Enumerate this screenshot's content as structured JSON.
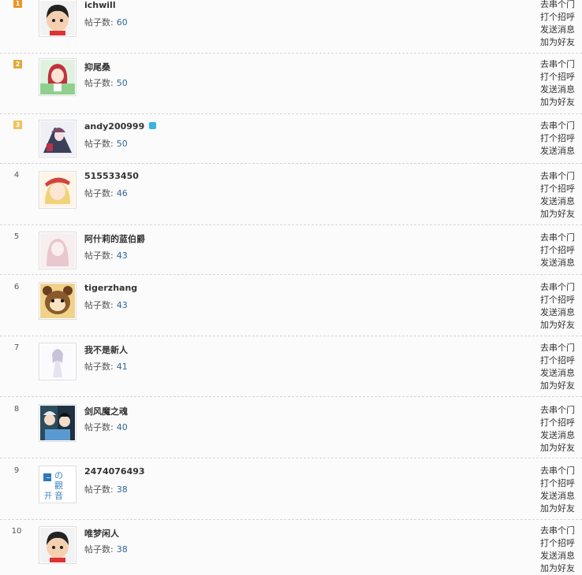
{
  "rows": [
    {
      "rank": "1",
      "name": "ichwill",
      "posts_label": "帖子数:",
      "posts": "60",
      "actions": [
        "去串个门",
        "打个招呼",
        "发送消息",
        "加为好友"
      ],
      "medal_color": "#e8962c"
    },
    {
      "rank": "2",
      "name": "抑尾桑",
      "posts_label": "帖子数:",
      "posts": "50",
      "actions": [
        "去串个门",
        "打个招呼",
        "发送消息",
        "加为好友"
      ],
      "medal_color": "#e0a93a"
    },
    {
      "rank": "3",
      "name": "andy200999",
      "posts_label": "帖子数:",
      "posts": "50",
      "actions": [
        "去串个门",
        "打个招呼",
        "发送消息"
      ],
      "medal_color": "#efc35a"
    },
    {
      "rank": "4",
      "name": "515533450",
      "posts_label": "帖子数:",
      "posts": "46",
      "actions": [
        "去串个门",
        "打个招呼",
        "发送消息",
        "加为好友"
      ]
    },
    {
      "rank": "5",
      "name": "阿什莉的蓝伯爵",
      "posts_label": "帖子数:",
      "posts": "43",
      "actions": [
        "去串个门",
        "打个招呼",
        "发送消息"
      ]
    },
    {
      "rank": "6",
      "name": "tigerzhang",
      "posts_label": "帖子数:",
      "posts": "43",
      "actions": [
        "去串个门",
        "打个招呼",
        "发送消息",
        "加为好友"
      ]
    },
    {
      "rank": "7",
      "name": "我不是新人",
      "posts_label": "帖子数:",
      "posts": "41",
      "actions": [
        "去串个门",
        "打个招呼",
        "发送消息",
        "加为好友"
      ]
    },
    {
      "rank": "8",
      "name": "剑风魔之魂",
      "posts_label": "帖子数:",
      "posts": "40",
      "actions": [
        "去串个门",
        "打个招呼",
        "发送消息",
        "加为好友"
      ]
    },
    {
      "rank": "9",
      "name": "2474076493",
      "posts_label": "帖子数:",
      "posts": "38",
      "actions": [
        "去串个门",
        "打个招呼",
        "发送消息",
        "加为好友"
      ]
    },
    {
      "rank": "10",
      "name": "唯梦闲人",
      "posts_label": "帖子数:",
      "posts": "38",
      "actions": [
        "去串个门",
        "打个招呼",
        "发送消息",
        "加为好友"
      ]
    }
  ],
  "avatar_icons": [
    "default-boy-avatar-icon",
    "anime-girl-red-hair-icon",
    "anime-mecha-girl-icon",
    "anime-girl-red-hat-icon",
    "anime-girl-pink-icon",
    "cartoon-bear-icon",
    "anime-girl-white-dress-icon",
    "anime-group-icon",
    "chinese-calligraphy-icon",
    "default-boy-avatar-icon"
  ],
  "vip_icon": "vip-badge-icon",
  "colors": {
    "link": "#333333",
    "count": "#336699",
    "divider": "#d6d6d6",
    "background": "#fbfbfb"
  }
}
